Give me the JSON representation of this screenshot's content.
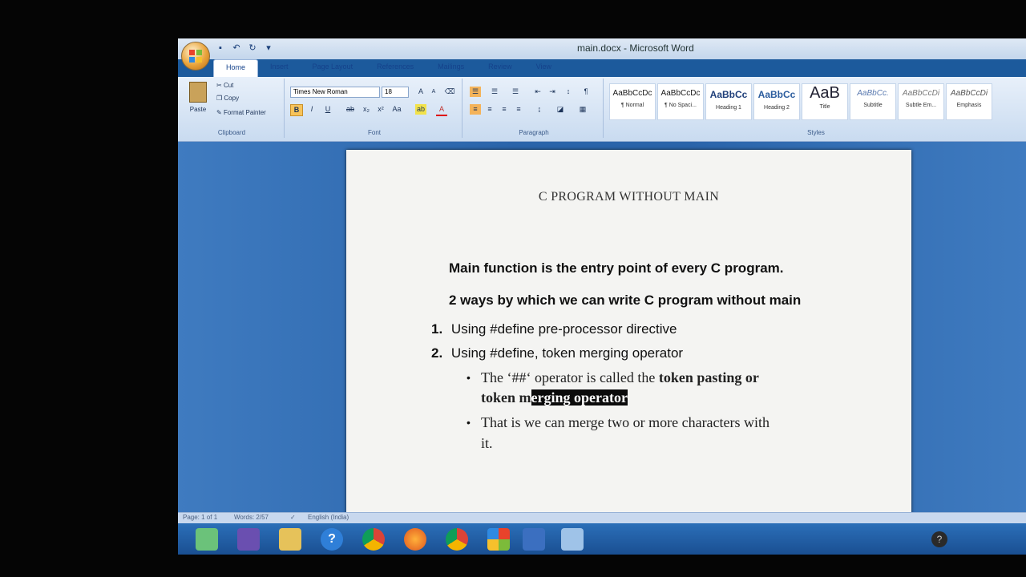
{
  "window": {
    "title": "main.docx - Microsoft Word"
  },
  "tabs": [
    "Home",
    "Insert",
    "Page Layout",
    "References",
    "Mailings",
    "Review",
    "View"
  ],
  "ribbon": {
    "clipboard": {
      "paste": "Paste",
      "cut": "Cut",
      "copy": "Copy",
      "format_painter": "Format Painter",
      "label": "Clipboard"
    },
    "font": {
      "name": "Times New Roman",
      "size": "18",
      "label": "Font"
    },
    "paragraph": {
      "label": "Paragraph"
    },
    "styles": {
      "label": "Styles",
      "items": [
        {
          "preview": "AaBbCcDc",
          "name": "¶ Normal"
        },
        {
          "preview": "AaBbCcDc",
          "name": "¶ No Spaci..."
        },
        {
          "preview": "AaBbCc",
          "name": "Heading 1"
        },
        {
          "preview": "AaBbCc",
          "name": "Heading 2"
        },
        {
          "preview": "AaB",
          "name": "Title"
        },
        {
          "preview": "AaBbCc.",
          "name": "Subtitle"
        },
        {
          "preview": "AaBbCcDi",
          "name": "Subtle Em..."
        },
        {
          "preview": "AaBbCcDi",
          "name": "Emphasis"
        }
      ]
    }
  },
  "document": {
    "title": "C  PROGRAM WITHOUT MAIN",
    "para1": "Main function is the entry point of every C program.",
    "para2": "2 ways by which we can write C program without main",
    "list": [
      {
        "num": "1.",
        "text": "Using  #define pre-processor directive"
      },
      {
        "num": "2.",
        "text": "Using  #define, token merging operator"
      }
    ],
    "bullet1": {
      "pre": "The ‘##‘ operator is called the ",
      "bold": "token pasting or",
      "line2_pre": "token  m",
      "selected": "erging operator"
    },
    "bullet2": {
      "line1": "That is we can merge two or more characters with",
      "line2": "it."
    },
    "bullet_glyph": "•"
  },
  "status": {
    "page": "Page: 1 of 1",
    "words": "Words: 2/57",
    "language": "English (India)"
  },
  "colors": {
    "ribbon": "#dbe7f6",
    "page": "#f4f4f2",
    "selection": "#0b0b0b",
    "taskbar": "#1f5aa2"
  }
}
